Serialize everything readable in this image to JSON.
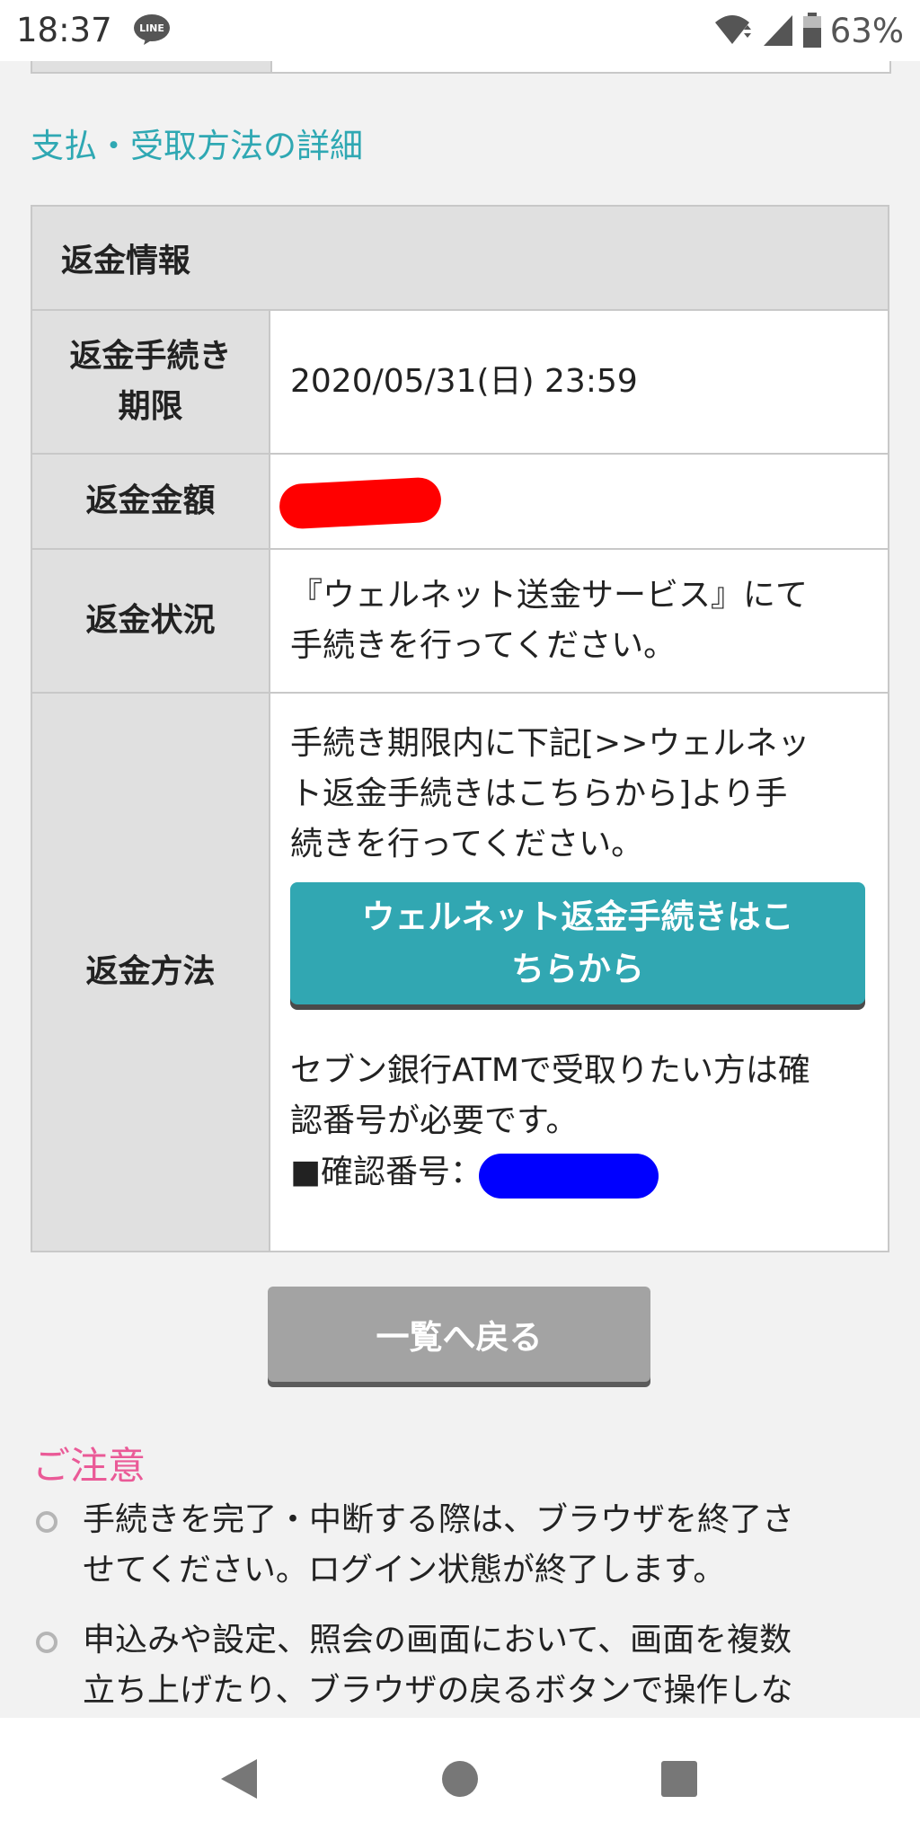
{
  "status_bar": {
    "time": "18:37",
    "notification_icon": "line-app-icon",
    "battery_percent": "63%"
  },
  "section": {
    "title": "支払・受取方法の詳細"
  },
  "refund_table": {
    "header": "返金情報",
    "rows": [
      {
        "label_line1": "返金手続き",
        "label_line2": "期限",
        "value": "2020/05/31(日) 23:59"
      },
      {
        "label": "返金金額"
      },
      {
        "label": "返金状況",
        "value_line1": "『ウェルネット送金サービス』にて",
        "value_line2": "手続きを行ってください。"
      },
      {
        "label": "返金方法",
        "instruction_line1": "手続き期限内に下記[>>ウェルネッ",
        "instruction_line2": "ト返金手続きはこちらから]より手",
        "instruction_line3": "続きを行ってください。",
        "button_line1": "ウェルネット返金手続きはこ",
        "button_line2": "ちらから",
        "atm_line1": "セブン銀行ATMで受取りたい方は確",
        "atm_line2": "認番号が必要です。",
        "confirm_label": "■確認番号："
      }
    ]
  },
  "back_button": "一覧へ戻る",
  "notes": {
    "title": "ご注意",
    "items": [
      {
        "line1": "手続きを完了・中断する際は、ブラウザを終了さ",
        "line2": "せてください。ログイン状態が終了します。"
      },
      {
        "line1": "申込みや設定、照会の画面において、画面を複数",
        "line2": "立ち上げたり、ブラウザの戻るボタンで操作しな"
      }
    ]
  },
  "colors": {
    "accent_teal": "#31a7b2",
    "notes_pink": "#ea5a97",
    "redaction_red": "#ff0000",
    "redaction_blue": "#0000ff"
  }
}
